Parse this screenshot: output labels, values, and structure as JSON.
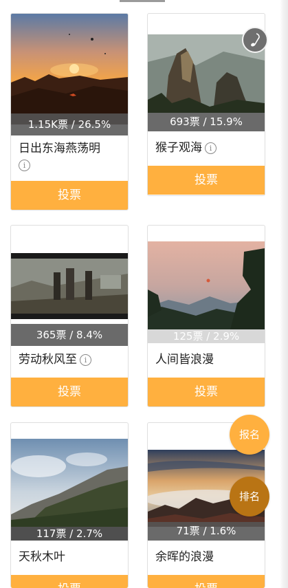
{
  "cards": [
    {
      "title": "日出东海燕荡明",
      "stats": "1.15K票 / 26.5%",
      "vote_label": "投票"
    },
    {
      "title": "猴子观海",
      "stats": "693票 / 15.9%",
      "vote_label": "投票"
    },
    {
      "title": "劳动秋风至",
      "stats": "365票 / 8.4%",
      "vote_label": "投票"
    },
    {
      "title": "人间皆浪漫",
      "stats": "125票 / 2.9%",
      "vote_label": "投票"
    },
    {
      "title": "天秋木叶",
      "stats": "117票 / 2.7%",
      "vote_label": "投票"
    },
    {
      "title": "余晖的浪漫",
      "stats": "71票 / 1.6%",
      "vote_label": "投票"
    }
  ],
  "info_glyph": "i",
  "fab": {
    "register_label": "报名",
    "ranking_label": "排名"
  },
  "colors": {
    "accent": "#ffb03f",
    "ranking_fab": "#b97414",
    "stats_overlay": "#555555"
  },
  "icons": [
    "music-icon",
    "info-icon"
  ]
}
